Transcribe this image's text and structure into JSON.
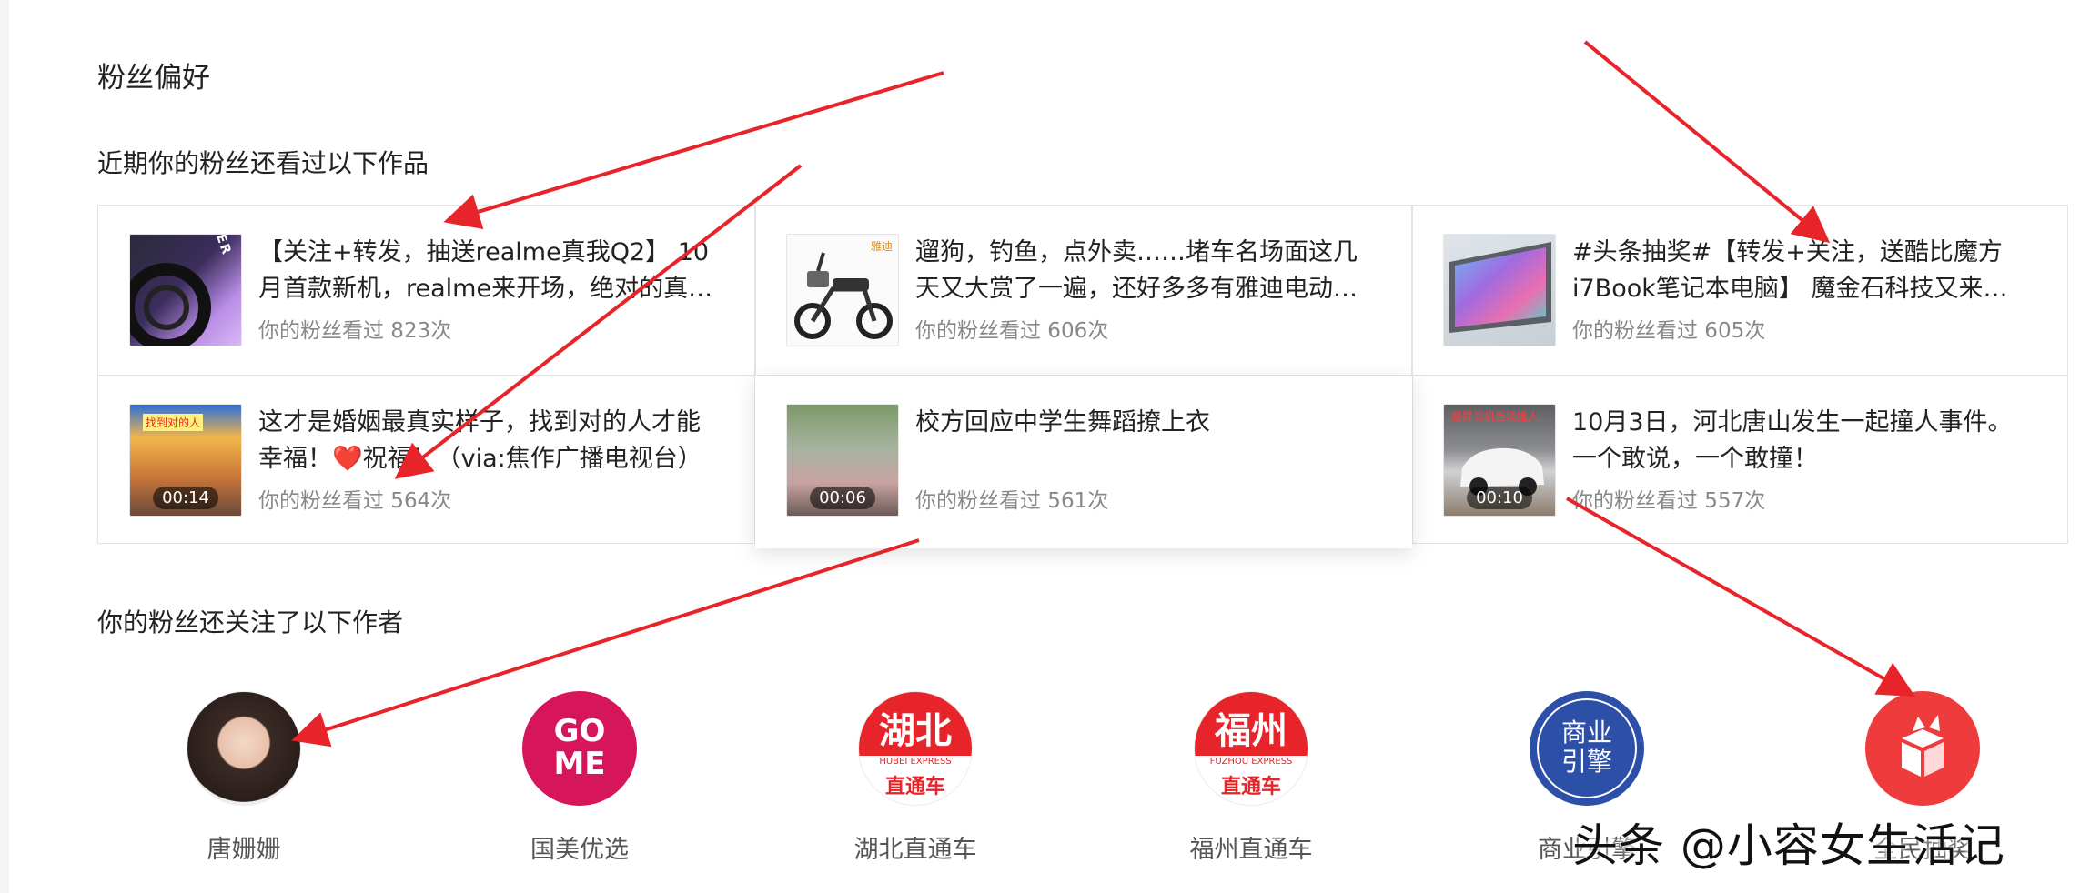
{
  "section_title": "粉丝偏好",
  "works_heading": "近期你的粉丝还看过以下作品",
  "works": [
    {
      "title": "【关注+转发，抽送realme真我Q2】 10月首款新机，realme来开场，绝对的真…",
      "meta": "你的粉丝看过 823次",
      "thumb_text": "JOKER",
      "duration": ""
    },
    {
      "title": "遛狗，钓鱼，点外卖……堵车名场面这几天又大赏了一遍，还好多多有雅迪电动…",
      "meta": "你的粉丝看过 606次",
      "thumb_text": "雅迪",
      "duration": ""
    },
    {
      "title": "#头条抽奖#【转发+关注，送酷比魔方i7Book笔记本电脑】 魔金石科技又来…",
      "meta": "你的粉丝看过 605次",
      "thumb_text": "",
      "duration": ""
    },
    {
      "title": "这才是婚姻最真实样子，找到对的人才能幸福！❤️祝福！（via:焦作广播电视台）",
      "meta": "你的粉丝看过 564次",
      "thumb_text": "找到对的人",
      "duration": "00:14"
    },
    {
      "title": "校方回应中学生舞蹈撩上衣",
      "meta": "你的粉丝看过 561次",
      "thumb_text": "",
      "duration": "00:06"
    },
    {
      "title": "10月3日，河北唐山发生一起撞人事件。一个敢说，一个敢撞！",
      "meta": "你的粉丝看过 557次",
      "thumb_text": "暴躁司机当场撞人",
      "duration": "00:10"
    }
  ],
  "authors_heading": "你的粉丝还关注了以下作者",
  "authors": [
    {
      "name": "唐姗姗",
      "logo": ""
    },
    {
      "name": "国美优选",
      "logo": "GO ME"
    },
    {
      "name": "湖北直通车",
      "logo": "湖北",
      "logo_sub": "HUBEI EXPRESS",
      "logo_sub2": "直通车"
    },
    {
      "name": "福州直通车",
      "logo": "福州",
      "logo_sub": "FUZHOU EXPRESS",
      "logo_sub2": "直通车"
    },
    {
      "name": "商业引擎",
      "logo": "商业引擎"
    },
    {
      "name": "全民抽奖",
      "logo": ""
    }
  ],
  "watermark": "头条 @小容女生活记",
  "colors": {
    "accent_red": "#e8242b",
    "gome": "#d6155a",
    "blue_badge": "#2c4fa8"
  }
}
